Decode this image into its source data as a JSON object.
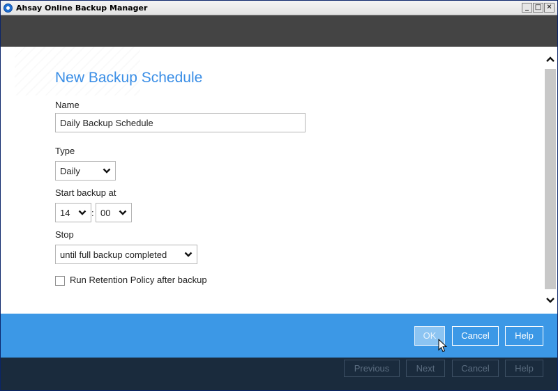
{
  "window": {
    "title": "Ahsay Online Backup Manager",
    "min_glyph": "_",
    "max_glyph": "□",
    "close_glyph": "✕"
  },
  "form": {
    "heading": "New Backup Schedule",
    "name_label": "Name",
    "name_value": "Daily Backup Schedule",
    "type_label": "Type",
    "type_value": "Daily",
    "start_label": "Start backup at",
    "start_hour": "14",
    "time_separator": ":",
    "start_minute": "00",
    "stop_label": "Stop",
    "stop_value": "until full backup completed",
    "retention_label": "Run Retention Policy after backup",
    "retention_checked": false
  },
  "actions": {
    "ok_label": "OK",
    "cancel_label": "Cancel",
    "help_label": "Help"
  },
  "footer": {
    "previous_label": "Previous",
    "next_label": "Next",
    "cancel_label": "Cancel",
    "help_label": "Help"
  },
  "colors": {
    "accent": "#3c98e6",
    "heading": "#3a8ee6",
    "header_dark": "#444444",
    "footer_dark": "#1a2b3d"
  }
}
